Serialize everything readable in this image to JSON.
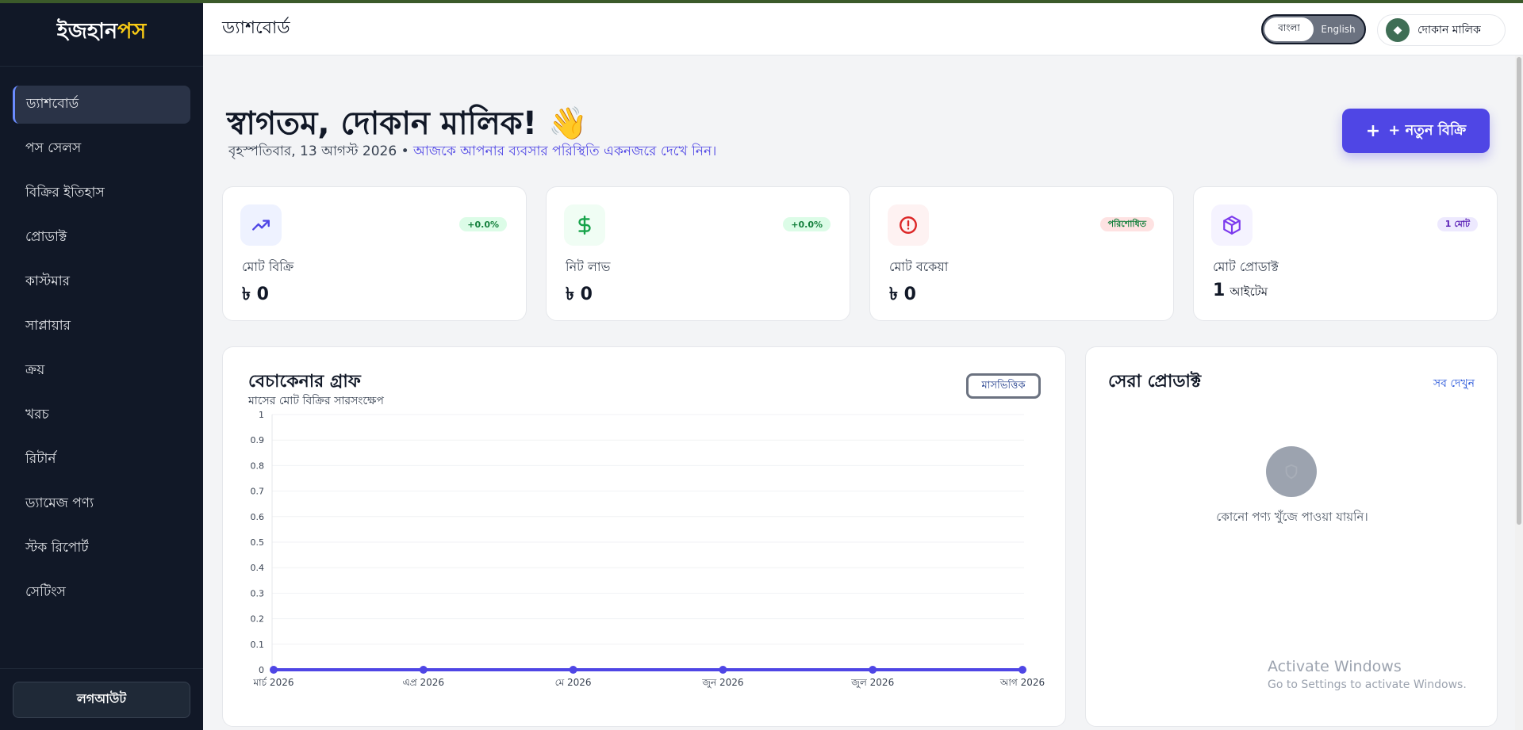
{
  "brand": {
    "part1": "ইজহান",
    "part2": "পস"
  },
  "sidebar": {
    "items": [
      {
        "label": "ড্যাশবোর্ড",
        "active": true
      },
      {
        "label": "পস সেলস"
      },
      {
        "label": "বিক্রির ইতিহাস"
      },
      {
        "label": "প্রোডাক্ট"
      },
      {
        "label": "কাস্টমার"
      },
      {
        "label": "সাপ্লায়ার"
      },
      {
        "label": "ক্রয়"
      },
      {
        "label": "খরচ"
      },
      {
        "label": "রিটার্ন"
      },
      {
        "label": "ড্যামেজ পণ্য"
      },
      {
        "label": "স্টক রিপোর্ট"
      },
      {
        "label": "সেটিংস"
      }
    ],
    "logout": "লগআউট"
  },
  "header": {
    "title": "ড্যাশবোর্ড",
    "lang_bn": "বাংলা",
    "lang_en": "English",
    "user_name": "দোকান মালিক",
    "avatar_icon": "diamond-icon"
  },
  "welcome": {
    "title": "স্বাগতম, দোকান মালিক! 👋",
    "date": "বৃহস্পতিবার, 13 আগস্ট 2026 •",
    "hint": "আজকে আপনার ব্যবসার পরিস্থিতি একনজরে দেখে নিন।",
    "new_sale_plus": "+",
    "new_sale_label": "+ নতুন বিক্রি"
  },
  "stats": [
    {
      "icon": "trending-up-icon",
      "badge": "+0.0%",
      "label": "মোট বিক্রি",
      "value": "৳ 0",
      "unit": "",
      "color": "#4f46e5",
      "bg": "#eef2ff",
      "badge_bg": "#dcfce7",
      "badge_color": "#15803d"
    },
    {
      "icon": "dollar-icon",
      "badge": "+0.0%",
      "label": "নিট লাভ",
      "value": "৳ 0",
      "unit": "",
      "color": "#16a34a",
      "bg": "#f0fdf4",
      "badge_bg": "#dcfce7",
      "badge_color": "#15803d"
    },
    {
      "icon": "alert-icon",
      "badge": "পরিশোধিত",
      "label": "মোট বকেয়া",
      "value": "৳ 0",
      "unit": "",
      "color": "#dc2626",
      "bg": "#fef2f2",
      "badge_bg": "#fee2e2",
      "badge_color": "#15803d"
    },
    {
      "icon": "box-icon",
      "badge": "1 মোট",
      "label": "মোট প্রোডাক্ট",
      "value": "1",
      "unit": "আইটেম",
      "color": "#7c3aed",
      "bg": "#f5f3ff",
      "badge_bg": "#ede9fe",
      "badge_color": "#5b21b6"
    }
  ],
  "chart": {
    "title": "বেচাকেনার গ্রাফ",
    "subtitle": "মাসের মোট বিক্রির সারসংক্ষেপ",
    "mode": "মাসভিত্তিক"
  },
  "chart_data": {
    "type": "line",
    "categories": [
      "মার্চ 2026",
      "এপ্র 2026",
      "মে 2026",
      "জুন 2026",
      "জুল 2026",
      "আগ 2026"
    ],
    "values": [
      0,
      0,
      0,
      0,
      0,
      0
    ],
    "yticks": [
      "0",
      "0.1",
      "0.2",
      "0.3",
      "0.4",
      "0.5",
      "0.6",
      "0.7",
      "0.8",
      "0.9",
      "1"
    ],
    "ylim": [
      0,
      1
    ],
    "color": "#4f46e5",
    "grid": true
  },
  "top_products": {
    "title": "সেরা প্রোডাক্ট",
    "see_all": "সব দেখুন",
    "empty_icon": "shield-icon",
    "empty_text": "কোনো পণ্য খুঁজে পাওয়া যায়নি।"
  },
  "watermark": {
    "line1": "Activate Windows",
    "line2": "Go to Settings to activate Windows."
  }
}
